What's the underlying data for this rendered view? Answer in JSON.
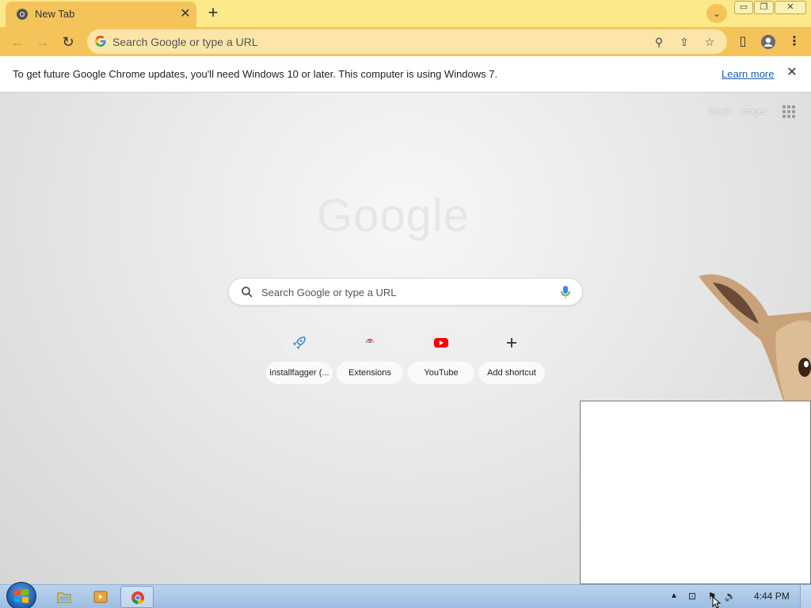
{
  "tab": {
    "title": "New Tab",
    "close": "✕"
  },
  "tabstrip": {
    "new_tab": "+",
    "tab_search": "⌄"
  },
  "window_controls": {
    "minimize": "▭",
    "maximize": "❐",
    "close": "✕"
  },
  "toolbar": {
    "back": "←",
    "forward": "→",
    "reload": "↻",
    "omnibox_placeholder": "Search Google or type a URL",
    "zoom": "⚲",
    "share": "⇪",
    "bookmark": "☆",
    "side_panel": "▯",
    "profile": "●",
    "menu": "⋮"
  },
  "infobar": {
    "message": "To get future Google Chrome updates, you'll need Windows 10 or later. This computer is using Windows 7.",
    "learn_more": "Learn more",
    "close": "✕"
  },
  "ntp": {
    "gmail": "Gmail",
    "images": "Images",
    "logo": "Google",
    "search_placeholder": "Search Google or type a URL",
    "shortcuts": [
      {
        "label": "installfagger (...",
        "icon": "rocket-icon"
      },
      {
        "label": "Extensions",
        "icon": "chrome-icon"
      },
      {
        "label": "YouTube",
        "icon": "youtube-icon"
      },
      {
        "label": "Add shortcut",
        "icon": "plus-icon"
      }
    ]
  },
  "taskbar": {
    "clock": "4:44 PM",
    "tray_up": "▲",
    "tray_network": "⊡",
    "tray_flag": "⚑",
    "tray_volume": "🔈"
  },
  "colors": {
    "tabstrip": "#fbe98a",
    "toolbar": "#f4c45a",
    "omnibox": "#fbe5a8",
    "link": "#1a5fb4",
    "youtube_red": "#ff0000"
  }
}
